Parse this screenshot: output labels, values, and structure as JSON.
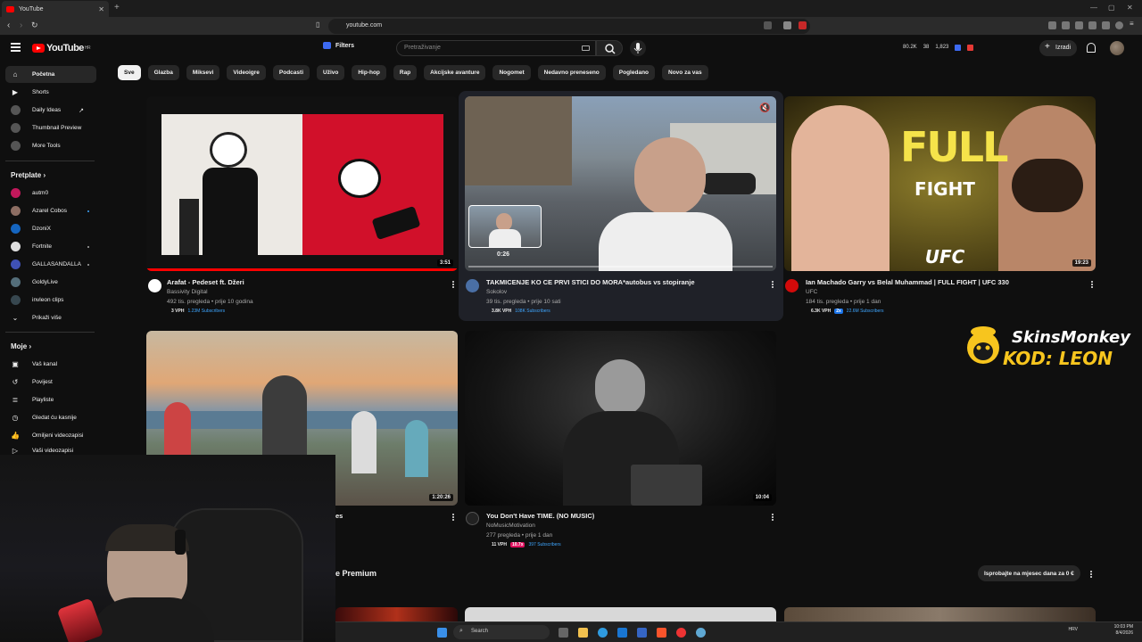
{
  "browser": {
    "tab_title": "YouTube",
    "url": "youtube.com"
  },
  "header": {
    "logo_text": "YouTube",
    "logo_region": "HR",
    "filters_label": "Filters",
    "search_placeholder": "Pretraživanje",
    "stats": [
      "80.2K",
      "38",
      "1,823"
    ],
    "create_label": "Izradi"
  },
  "sidebar": {
    "main": [
      {
        "label": "Početna",
        "icon": "home-icon",
        "active": true
      },
      {
        "label": "Shorts",
        "icon": "shorts-icon"
      },
      {
        "label": "Daily Ideas",
        "icon": "daily-ideas-icon"
      },
      {
        "label": "Thumbnail Preview",
        "icon": "thumbnail-preview-icon"
      },
      {
        "label": "More Tools",
        "icon": "more-tools-icon"
      }
    ],
    "subscriptions_header": "Pretplate",
    "subscriptions": [
      {
        "label": "autm0",
        "color": "#c2185b"
      },
      {
        "label": "Azarel Cobos",
        "color": "#8d6e63",
        "dot": true
      },
      {
        "label": "DzoniX",
        "color": "#1565c0"
      },
      {
        "label": "Fortnite",
        "color": "#e0e0e0",
        "dot": true
      },
      {
        "label": "GALLASANDALLA",
        "color": "#3f51b5",
        "dot": true
      },
      {
        "label": "GoldyLive",
        "color": "#546e7a"
      },
      {
        "label": "invleon clips",
        "color": "#37474f"
      }
    ],
    "show_more": "Prikaži više",
    "you_header": "Moje",
    "you": [
      {
        "label": "Vaš kanal",
        "icon": "your-channel-icon"
      },
      {
        "label": "Povijest",
        "icon": "history-icon"
      },
      {
        "label": "Playliste",
        "icon": "playlists-icon"
      },
      {
        "label": "Gledat ću kasnije",
        "icon": "watch-later-icon"
      },
      {
        "label": "Omiljeni videozapisi",
        "icon": "liked-videos-icon"
      },
      {
        "label": "Vaši videozapisi",
        "icon": "your-videos-icon"
      }
    ]
  },
  "chips": [
    "Sve",
    "Glazba",
    "Miksevi",
    "Videoigre",
    "Podcasti",
    "Uživo",
    "Hip-hop",
    "Rap",
    "Akcijske avanture",
    "Nogomet",
    "Nedavno preneseno",
    "Pogledano",
    "Novo za vas"
  ],
  "videos": [
    {
      "title": "Arafat - Pedeset ft. Džeri",
      "channel": "Bassivity Digital",
      "meta": "492 tis. pregleda • prije 10 godina",
      "duration": "3:51",
      "vph": "3 VPH",
      "subs": "1.23M Subscribers"
    },
    {
      "title": "TAKMICENJE KO CE PRVI STICI DO MORA*autobus vs stopiranje",
      "channel": "Sokolov",
      "meta": "39 tis. pregleda • prije 10 sati",
      "preview_time": "0:26",
      "vph": "3.8K VPH",
      "subs": "108K Subscribers"
    },
    {
      "title": "Ian Machado Garry vs Belal Muhammad | FULL FIGHT | UFC 330",
      "channel": "UFC",
      "meta": "184 tis. pregleda • prije 1 dan",
      "duration": "19:23",
      "vph": "6.3K VPH",
      "mult": "2x",
      "subs": "22.6M Subscribers",
      "thumb_text_1": "FULL",
      "thumb_text_2": "FIGHT",
      "thumb_logo": "UFC"
    },
    {
      "title": "es",
      "duration": "1:20:26"
    },
    {
      "title": "You Don't Have TIME. (NO MUSIC)",
      "channel": "NoMusicMotivation",
      "meta": "277 pregleda • prije 1 dan",
      "duration": "10:04",
      "vph": "11 VPH",
      "mult": "10.7x",
      "subs": "397 Subscribers"
    }
  ],
  "premium": {
    "title_partial": "e Premium",
    "cta": "Isprobajte na mjesec dana za 0 €"
  },
  "sponsor": {
    "line1": "SkinsMonkey",
    "line2": "KOD: LEON"
  },
  "taskbar": {
    "search_placeholder": "Search",
    "lang": "HRV",
    "time": "10:03 PM",
    "date": "8/4/2026"
  }
}
